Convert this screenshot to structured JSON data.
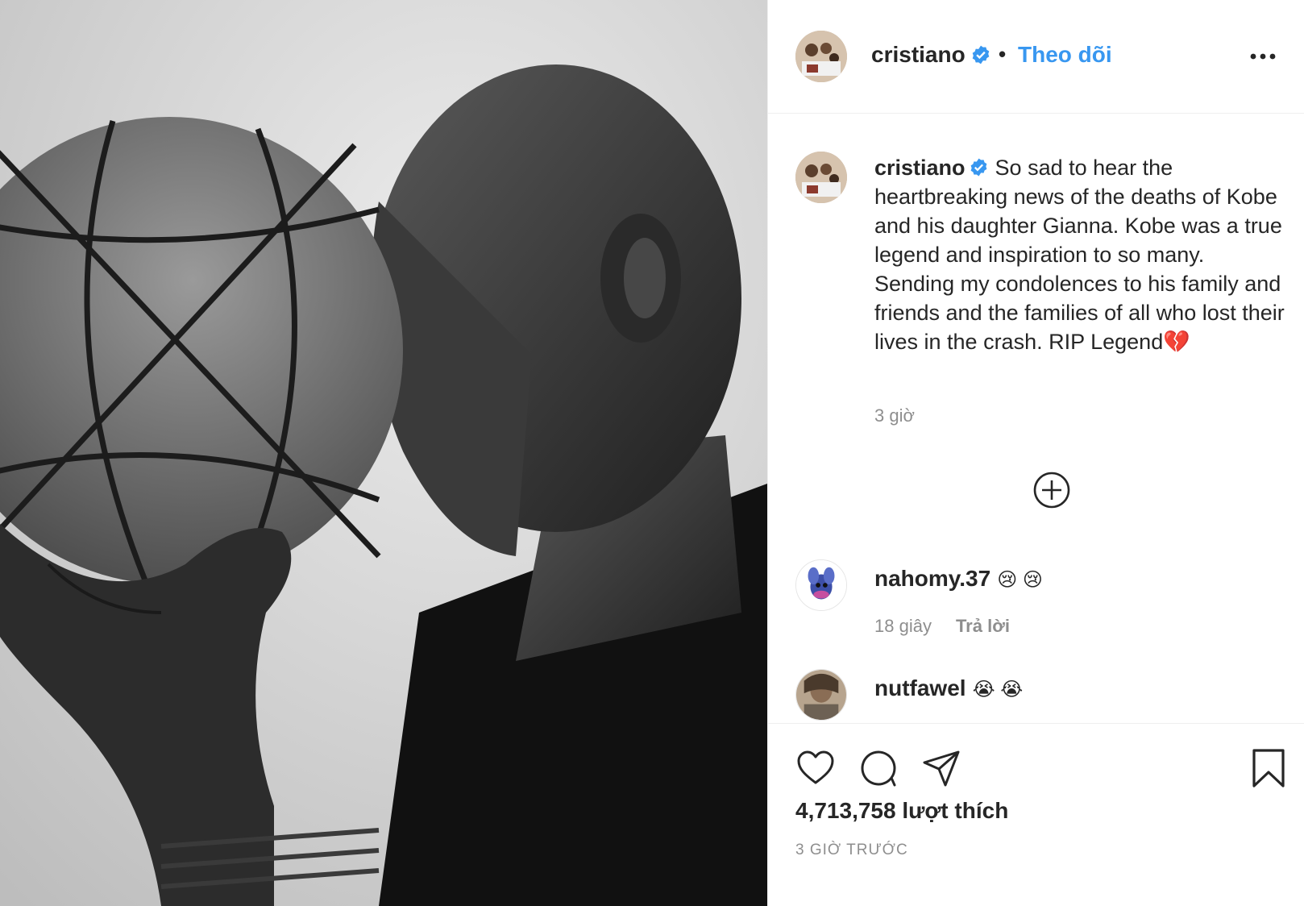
{
  "post": {
    "username": "cristiano",
    "dot": "•",
    "follow_label": "Theo dõi",
    "caption": "So sad to hear the heartbreaking news of the deaths of Kobe and his daughter Gianna. Kobe was a true legend and inspiration to so many. Sending my condolences to his family and friends and the families of all who lost their lives in the crash. RIP Legend💔",
    "caption_time": "3 giờ",
    "likes": "4,713,758 lượt thích",
    "posted_ago": "3 GIỜ TRƯỚC"
  },
  "comments": [
    {
      "username": "nahomy.37",
      "text": "😢 😢",
      "time": "18 giây",
      "reply_label": "Trả lời"
    },
    {
      "username": "nutfawel",
      "text": "😭 😭"
    }
  ],
  "colors": {
    "link": "#3897f0",
    "verified": "#3897f0",
    "muted": "#8e8e8e",
    "text": "#262626"
  },
  "icons": [
    "verified-icon",
    "more-icon",
    "load-more-icon",
    "heart-icon",
    "comment-icon",
    "share-icon",
    "bookmark-icon"
  ]
}
